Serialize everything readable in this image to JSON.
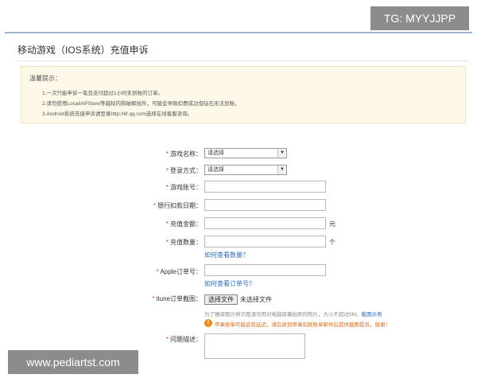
{
  "watermarks": {
    "tg": "TG: MYYJJPP",
    "site": "www.pediartst.com"
  },
  "page": {
    "title": "移动游戏（IOS系统）充值申诉"
  },
  "tips": {
    "heading": "温馨提示：",
    "items": [
      "1.一次只能申诉一笔且支付超过1小时未到账的订单。",
      "2.请勿使用LocalIAPStore等越狱内购破解插件，可能会导致扣费成功但钻石无法到账。",
      "3.Android系统充值申诉请登录http://kf.qq.com选择在线客服咨询。"
    ]
  },
  "form": {
    "game_name": {
      "label": "游戏名称：",
      "value": "请选择"
    },
    "login_method": {
      "label": "登录方式：",
      "value": "请选择"
    },
    "game_account": {
      "label": "游戏账号："
    },
    "bank_debit_date": {
      "label": "银行扣款日期："
    },
    "amount": {
      "label": "充值金额：",
      "unit": "元"
    },
    "quantity": {
      "label": "充值数量：",
      "unit": "个",
      "link": "如何查看数量？"
    },
    "apple_order": {
      "label": "Apple订单号：",
      "link": "如何查看订单号？"
    },
    "itunes_screenshot": {
      "label": "itune订单截图：",
      "button": "选择文件",
      "status": "未选择文件",
      "help": "为了确保图片辨识度请勿用对电脑屏幕拍照的照片，大小不超过5M。",
      "help_link": "截图示例",
      "warning": "苹果账单可能会有延迟，请在收到苹果扣款账单邮件后提供截图投诉，谢谢！"
    },
    "description": {
      "label": "问题描述："
    }
  },
  "icons": {
    "select_arrow": "chevron-down-icon",
    "warning": "warning-icon"
  },
  "colors": {
    "link": "#2b6dbf",
    "required": "#d04a1a",
    "warning": "#e36b12",
    "tips_bg": "#fdf8e8"
  }
}
